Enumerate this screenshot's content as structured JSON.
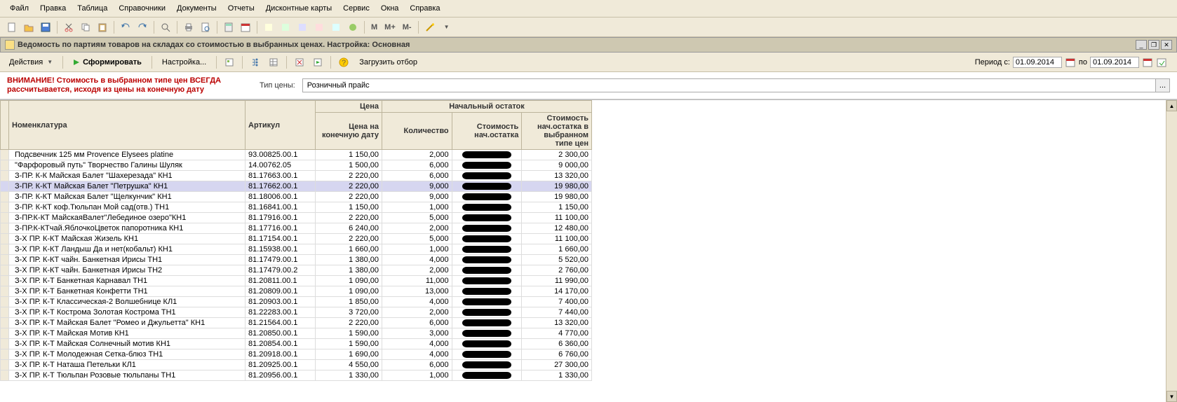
{
  "menu": [
    "Файл",
    "Правка",
    "Таблица",
    "Справочники",
    "Документы",
    "Отчеты",
    "Дисконтные карты",
    "Сервис",
    "Окна",
    "Справка"
  ],
  "mtext": {
    "m": "М",
    "mplus": "М+",
    "mminus": "М-"
  },
  "window": {
    "title": "Ведомость по партиям товаров на складах со стоимостью в выбранных ценах. Настройка: Основная"
  },
  "actions": {
    "actions": "Действия",
    "form": "Сформировать",
    "settings": "Настройка...",
    "load": "Загрузить отбор"
  },
  "period": {
    "label_from": "Период с:",
    "from": "01.09.2014",
    "label_to": "по",
    "to": "01.09.2014"
  },
  "warn": "ВНИМАНИЕ! Стоимость в выбранном типе цен ВСЕГДА рассчитывается, исходя из цены на конечную дату",
  "tip": {
    "label": "Тип цены:",
    "value": "Розничный прайс",
    "pick": "..."
  },
  "cols": {
    "nom": "Номенклатура",
    "art": "Артикул",
    "price": "Цена",
    "price_end": "Цена на конечную дату",
    "startbal": "Начальный остаток",
    "qty": "Количество",
    "cost": "Стоимость нач.остатка",
    "cost_sel": "Стоимость нач.остатка в выбранном типе цен"
  },
  "rows": [
    {
      "nom": "Подсвечник 125 мм Provence Elysees  platine",
      "art": "93.00825.00.1",
      "pe": "1 150,00",
      "qty": "2,000",
      "cs": "2 300,00"
    },
    {
      "nom": "\"Фарфоровый путь\"  Творчество Галины Шуляк",
      "art": "14.00762.05",
      "pe": "1 500,00",
      "qty": "6,000",
      "cs": "9 000,00"
    },
    {
      "nom": "З-ПР. К-К  Майская  Балет \"Шахерезада\" КН1",
      "art": "81.17663.00.1",
      "pe": "2 220,00",
      "qty": "6,000",
      "cs": "13 320,00"
    },
    {
      "nom": "З-ПР. К-КТ  Майская  Балет  \"Петрушка\"   КН1",
      "art": "81.17662.00.1",
      "pe": "2 220,00",
      "qty": "9,000",
      "cs": "19 980,00",
      "sel": true
    },
    {
      "nom": "З-ПР. К-КТ  Майская  Балет \"Щелкунчик\" КН1",
      "art": "81.18006.00.1",
      "pe": "2 220,00",
      "qty": "9,000",
      "cs": "19 980,00"
    },
    {
      "nom": "З-ПР. К-КТ коф.Тюльпан Мой сад(отв.) ТН1",
      "art": "81.16841.00.1",
      "pe": "1 150,00",
      "qty": "1,000",
      "cs": "1 150,00"
    },
    {
      "nom": "З-ПР.К-КТ МайскаяBалет\"Лебединое озеро\"КН1",
      "art": "81.17916.00.1",
      "pe": "2 220,00",
      "qty": "5,000",
      "cs": "11 100,00"
    },
    {
      "nom": "З-ПР.К-КТчай.ЯблочкоЦветок папоротника КН1",
      "art": "81.17716.00.1",
      "pe": "6 240,00",
      "qty": "2,000",
      "cs": "12 480,00"
    },
    {
      "nom": "З-Х ПР. К-КТ    Майская     Жизель   КН1",
      "art": "81.17154.00.1",
      "pe": "2 220,00",
      "qty": "5,000",
      "cs": "11 100,00"
    },
    {
      "nom": "З-Х ПР. К-КТ Ландыш Да и нет(кобальт) КН1",
      "art": "81.15938.00.1",
      "pe": "1 660,00",
      "qty": "1,000",
      "cs": "1 660,00"
    },
    {
      "nom": "З-Х ПР. К-КТ чайн. Банкетная    Ирисы  ТН1",
      "art": "81.17479.00.1",
      "pe": "1 380,00",
      "qty": "4,000",
      "cs": "5 520,00"
    },
    {
      "nom": "З-Х ПР. К-КТ чайн. Банкетная    Ирисы  ТН2",
      "art": "81.17479.00.2",
      "pe": "1 380,00",
      "qty": "2,000",
      "cs": "2 760,00"
    },
    {
      "nom": "З-Х ПР. К-Т Банкетная Карнавал ТН1",
      "art": "81.20811.00.1",
      "pe": "1 090,00",
      "qty": "11,000",
      "cs": "11 990,00"
    },
    {
      "nom": "З-Х ПР. К-Т Банкетная Конфетти ТН1",
      "art": "81.20809.00.1",
      "pe": "1 090,00",
      "qty": "13,000",
      "cs": "14 170,00"
    },
    {
      "nom": "З-Х ПР. К-Т Классическая-2 Волшебнице КЛ1",
      "art": "81.20903.00.1",
      "pe": "1 850,00",
      "qty": "4,000",
      "cs": "7 400,00"
    },
    {
      "nom": "З-Х ПР. К-Т Кострома Золотая Кострома ТН1",
      "art": "81.22283.00.1",
      "pe": "3 720,00",
      "qty": "2,000",
      "cs": "7 440,00"
    },
    {
      "nom": "З-Х ПР. К-Т Майская Балет \"Ромео и Джульетта\" КН1",
      "art": "81.21564.00.1",
      "pe": "2 220,00",
      "qty": "6,000",
      "cs": "13 320,00"
    },
    {
      "nom": "З-Х ПР. К-Т Майская Мотив КН1",
      "art": "81.20850.00.1",
      "pe": "1 590,00",
      "qty": "3,000",
      "cs": "4 770,00"
    },
    {
      "nom": "З-Х ПР. К-Т Майская Солнечный мотив КН1",
      "art": "81.20854.00.1",
      "pe": "1 590,00",
      "qty": "4,000",
      "cs": "6 360,00"
    },
    {
      "nom": "З-Х ПР. К-Т Молодежная Сетка-блюз ТН1",
      "art": "81.20918.00.1",
      "pe": "1 690,00",
      "qty": "4,000",
      "cs": "6 760,00"
    },
    {
      "nom": "З-Х ПР. К-Т Наташа Петельки КЛ1",
      "art": "81.20925.00.1",
      "pe": "4 550,00",
      "qty": "6,000",
      "cs": "27 300,00"
    },
    {
      "nom": "З-Х ПР. К-Т Тюльпан Розовые тюльпаны ТН1",
      "art": "81.20956.00.1",
      "pe": "1 330,00",
      "qty": "1,000",
      "cs": "1 330,00"
    }
  ]
}
